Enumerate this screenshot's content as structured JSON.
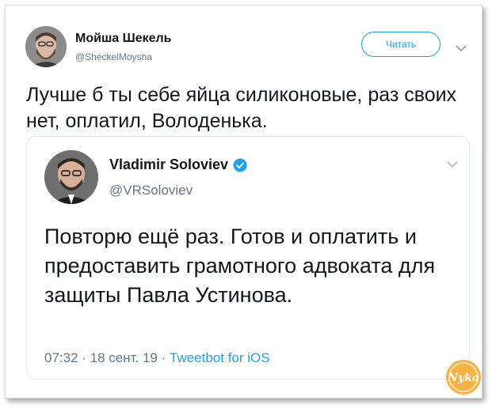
{
  "tweet": {
    "author_name": "Мойша Шекель",
    "author_handle": "@SheckelMoysha",
    "follow_label": "Читать",
    "text": "Лучше б ты себе яйца силиконовые, раз своих нет, оплатил, Володенька."
  },
  "quoted_tweet": {
    "author_name": "Vladimir Soloviev",
    "author_handle": "@VRSoloviev",
    "verified": true,
    "text": "Повторю ещё раз. Готов и оплатить и предоставить грамотного адвоката для защиты Павла Устинова.",
    "time": "07:32",
    "date": "18 сент. 19",
    "separator": " · ",
    "source": "Tweetbot for iOS"
  },
  "watermark": {
    "text": "Nyka",
    "icon": "watermark-logo"
  },
  "colors": {
    "accent": "#1da1f2",
    "text": "#14171a",
    "secondary": "#657786",
    "border": "#e1e8ed",
    "watermark": "#f5a623"
  }
}
